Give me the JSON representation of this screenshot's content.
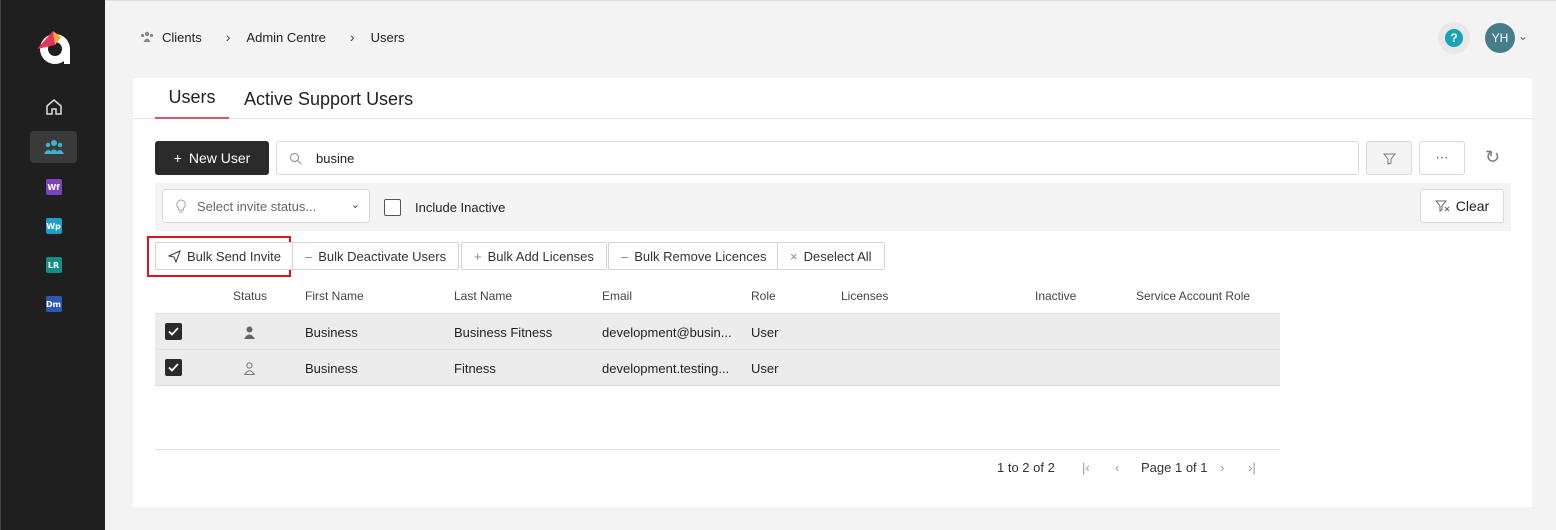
{
  "sidebar": {
    "items": [
      {
        "name": "home",
        "active": false
      },
      {
        "name": "clients",
        "active": true
      },
      {
        "name": "app-wf",
        "badge": "Wf",
        "color": "#7b44b8"
      },
      {
        "name": "app-wp",
        "badge": "Wp",
        "color": "#1b9ec7"
      },
      {
        "name": "app-lr",
        "badge": "LR",
        "color": "#138f86"
      },
      {
        "name": "app-dm",
        "badge": "Dm",
        "color": "#2c59b8"
      }
    ]
  },
  "breadcrumb": {
    "items": [
      "Clients",
      "Admin Centre",
      "Users"
    ]
  },
  "header": {
    "help": "?",
    "avatar": "YH"
  },
  "tabs": [
    "Users",
    "Active Support Users"
  ],
  "toolbar": {
    "new_user": "New User",
    "search_value": "busine"
  },
  "filters": {
    "invite_status_placeholder": "Select invite status...",
    "include_inactive": "Include Inactive",
    "clear": "Clear"
  },
  "bulk_actions": {
    "send_invite": "Bulk Send Invite",
    "deactivate": "Bulk Deactivate Users",
    "add_licenses": "Bulk Add Licenses",
    "remove_licences": "Bulk Remove Licences",
    "deselect_all": "Deselect All"
  },
  "table": {
    "columns": [
      "Status",
      "First Name",
      "Last Name",
      "Email",
      "Role",
      "Licenses",
      "Inactive",
      "Service Account Role"
    ],
    "rows": [
      {
        "selected": true,
        "status": "active",
        "first_name": "Business",
        "last_name": "Business Fitness",
        "email": "development@busin...",
        "role": "User"
      },
      {
        "selected": true,
        "status": "invited",
        "first_name": "Business",
        "last_name": "Fitness",
        "email": "development.testing...",
        "role": "User"
      }
    ]
  },
  "pagination": {
    "summary": "1 to 2 of 2",
    "page": "Page 1 of 1"
  },
  "colors": {
    "sidebar": "#1f1f1f",
    "accent_tab": "#d95b6a",
    "highlight": "#e0141e",
    "avatar": "#457e88",
    "help": "#1aa3b6"
  }
}
